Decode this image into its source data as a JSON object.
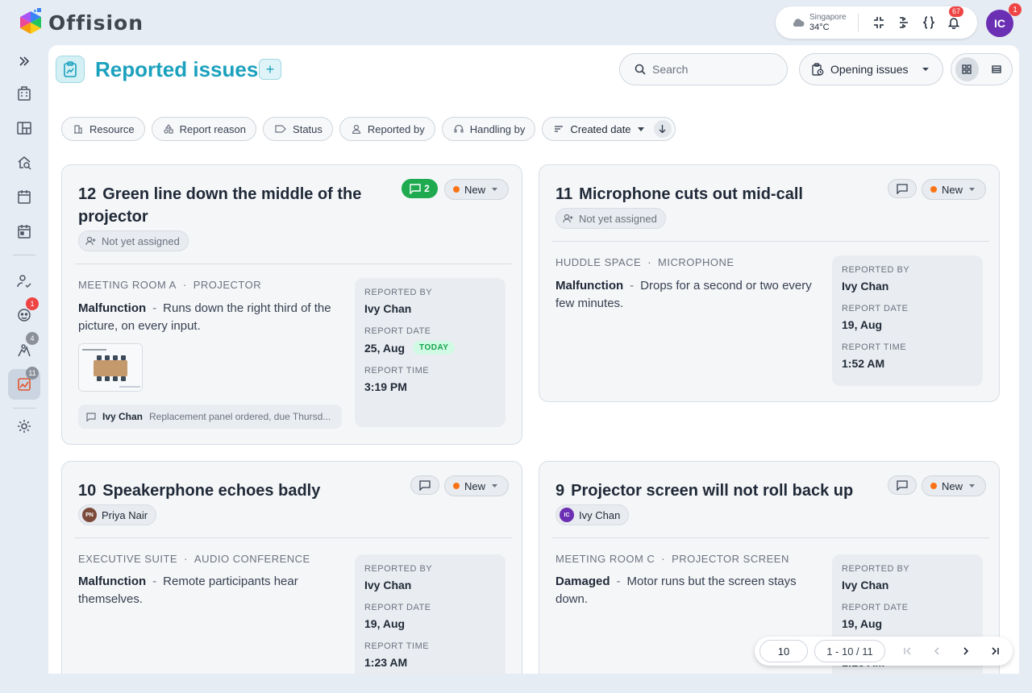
{
  "app": {
    "name": "Offision"
  },
  "topbar": {
    "weather_city": "Singapore",
    "weather_temp": "34°C",
    "notifications_count": "67",
    "user_initials": "IC",
    "user_badge": "1"
  },
  "sidebar": {
    "badges": {
      "guests": "1",
      "requests": "4",
      "issues": "11"
    }
  },
  "page": {
    "title": "Reported issues",
    "add_label": "+",
    "search_placeholder": "Search",
    "issue_filter": "Opening issues"
  },
  "filters": {
    "resource": "Resource",
    "reason": "Report reason",
    "status": "Status",
    "reported_by": "Reported by",
    "handling_by": "Handling by",
    "sort": "Created date"
  },
  "labels": {
    "reported_by": "REPORTED BY",
    "report_date": "REPORT DATE",
    "report_time": "REPORT TIME",
    "today": "TODAY"
  },
  "issues": [
    {
      "id": "12",
      "title": "Green line down the middle of the projector",
      "assignee": "Not yet assigned",
      "comments": "2",
      "status": "New",
      "location": "MEETING ROOM A",
      "resource": "PROJECTOR",
      "reason": "Malfunction",
      "description": "Runs down the right third of the picture, on every input.",
      "reported_by": "Ivy Chan",
      "report_date": "25, Aug",
      "report_time": "3:19 PM",
      "last_comment_author": "Ivy Chan",
      "last_comment": "Replacement panel ordered, due Thursd..."
    },
    {
      "id": "11",
      "title": "Microphone cuts out mid-call",
      "assignee": "Not yet assigned",
      "status": "New",
      "location": "HUDDLE SPACE",
      "resource": "MICROPHONE",
      "reason": "Malfunction",
      "description": "Drops for a second or two every few minutes.",
      "reported_by": "Ivy Chan",
      "report_date": "19, Aug",
      "report_time": "1:52 AM"
    },
    {
      "id": "10",
      "title": "Speakerphone echoes badly",
      "assignee": "Priya Nair",
      "assignee_initials": "PN",
      "status": "New",
      "location": "EXECUTIVE SUITE",
      "resource": "AUDIO CONFERENCE",
      "reason": "Malfunction",
      "description": "Remote participants hear themselves.",
      "reported_by": "Ivy Chan",
      "report_date": "19, Aug",
      "report_time": "1:23 AM"
    },
    {
      "id": "9",
      "title": "Projector screen will not roll back up",
      "assignee": "Ivy Chan",
      "assignee_initials": "IC",
      "status": "New",
      "location": "MEETING ROOM C",
      "resource": "PROJECTOR SCREEN",
      "reason": "Damaged",
      "description": "Motor runs but the screen stays down.",
      "reported_by": "Ivy Chan",
      "report_date": "19, Aug",
      "report_time": "1:23 AM"
    }
  ],
  "pagination": {
    "page_size": "10",
    "range": "1 - 10 / 11"
  },
  "colors": {
    "accent": "#1ba1bd",
    "status_new": "#f97316",
    "comment_active": "#1faa4f",
    "badge": "#ef4444"
  }
}
